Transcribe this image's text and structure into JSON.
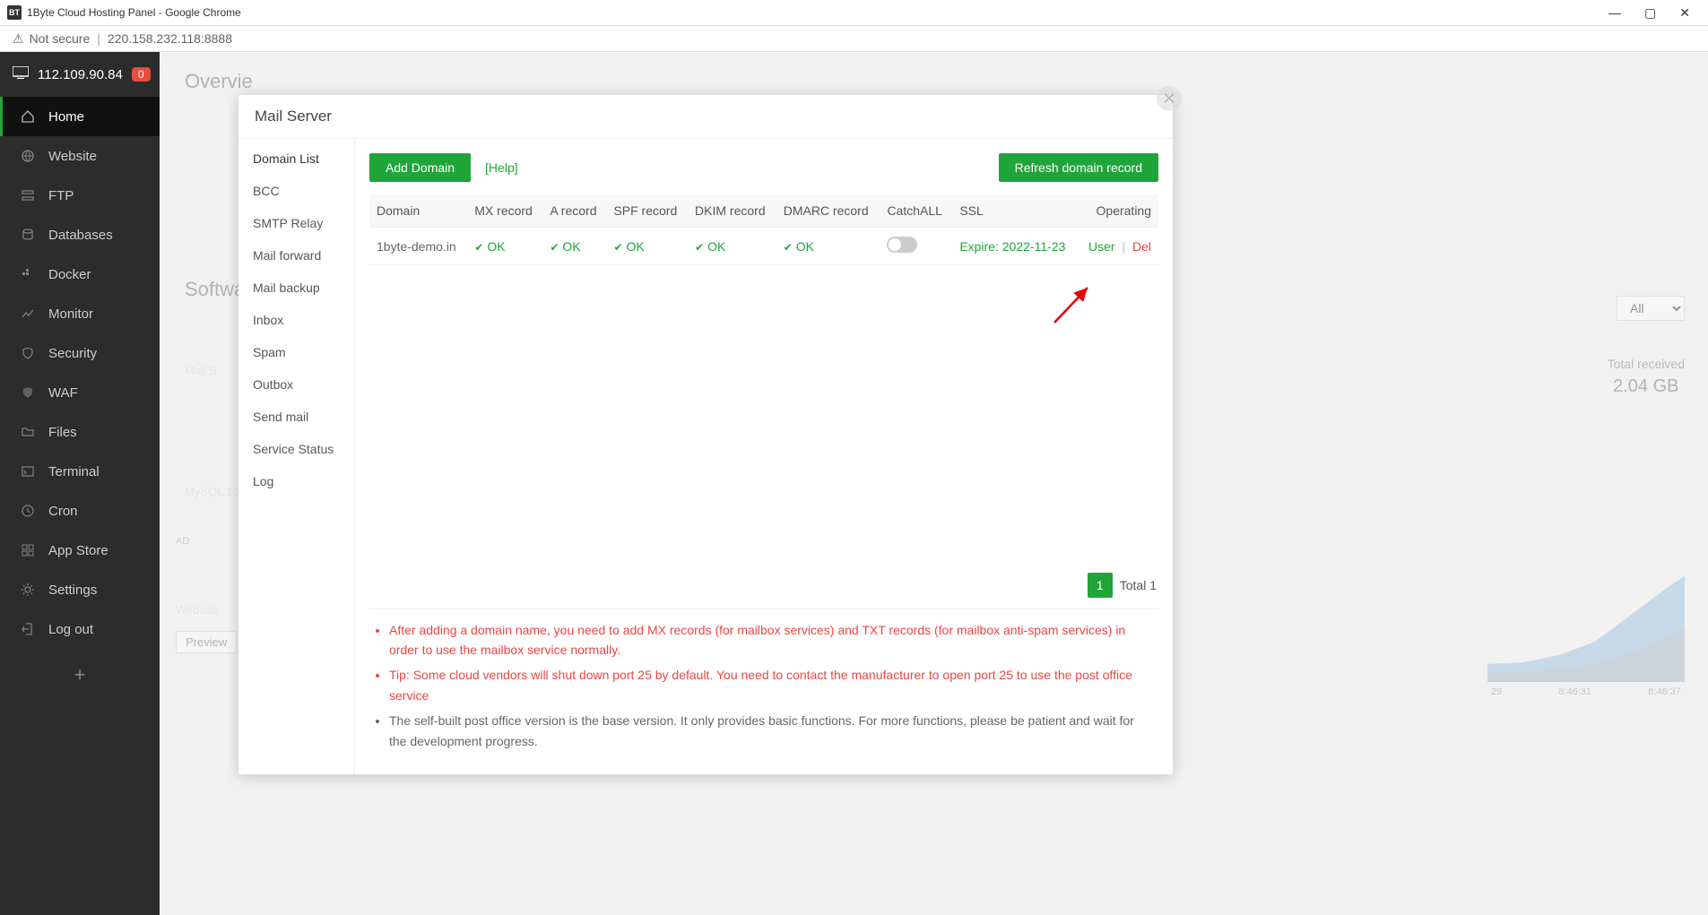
{
  "window": {
    "title": "1Byte Cloud Hosting Panel - Google Chrome",
    "favicon_text": "BT"
  },
  "addressbar": {
    "not_secure": "Not secure",
    "url": "220.158.232.118:8888"
  },
  "sidebar": {
    "ip": "112.109.90.84",
    "badge": "0",
    "items": [
      {
        "label": "Home",
        "active": true
      },
      {
        "label": "Website"
      },
      {
        "label": "FTP"
      },
      {
        "label": "Databases"
      },
      {
        "label": "Docker"
      },
      {
        "label": "Monitor"
      },
      {
        "label": "Security"
      },
      {
        "label": "WAF"
      },
      {
        "label": "Files"
      },
      {
        "label": "Terminal"
      },
      {
        "label": "Cron"
      },
      {
        "label": "App Store"
      },
      {
        "label": "Settings"
      },
      {
        "label": "Log out"
      }
    ]
  },
  "main": {
    "overview_title": "Overvie",
    "software_title": "Softwa",
    "ad_label": "AD",
    "filter_all": "All",
    "preview": "Preview",
    "website_card": "Website",
    "mysql_card": "MySQL 10",
    "mail_card": "Mail S",
    "traffic_label": "Total received",
    "traffic_value": "2.04 GB",
    "time1": "29",
    "time2": "8:46:31",
    "time3": "8:46:37"
  },
  "modal": {
    "title": "Mail Server",
    "tabs": [
      "Domain List",
      "BCC",
      "SMTP Relay",
      "Mail forward",
      "Mail backup",
      "Inbox",
      "Spam",
      "Outbox",
      "Send mail",
      "Service Status",
      "Log"
    ],
    "add_domain": "Add Domain",
    "help": "[Help]",
    "refresh": "Refresh domain record",
    "columns": [
      "Domain",
      "MX record",
      "A record",
      "SPF record",
      "DKIM record",
      "DMARC record",
      "CatchALL",
      "SSL",
      "Operating"
    ],
    "row": {
      "domain": "1byte-demo.in",
      "mx": "OK",
      "a": "OK",
      "spf": "OK",
      "dkim": "OK",
      "dmarc": "OK",
      "ssl": "Expire: 2022-11-23",
      "user": "User",
      "del": "Del"
    },
    "page_current": "1",
    "page_total": "Total 1",
    "tips": [
      "After adding a domain name, you need to add MX records (for mailbox services) and TXT records (for mailbox anti-spam services) in order to use the mailbox service normally.",
      "Tip: Some cloud vendors will shut down port 25 by default. You need to contact the manufacturer to open port 25 to use the post office service",
      "The self-built post office version is the base version. It only provides basic functions. For more functions, please be patient and wait for the development progress."
    ]
  }
}
